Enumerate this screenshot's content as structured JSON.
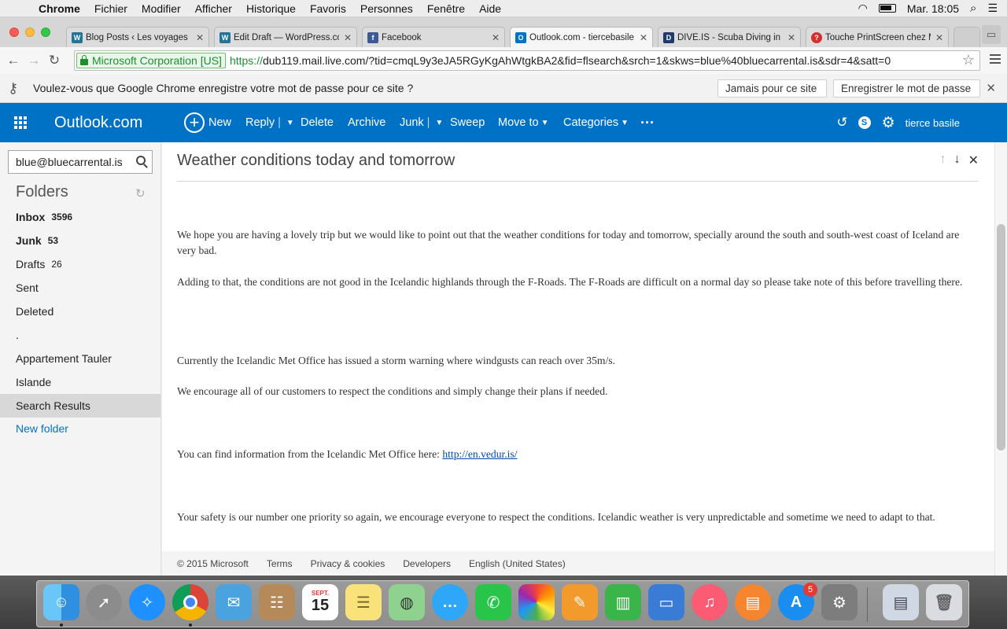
{
  "menubar": {
    "app": "Chrome",
    "items": [
      "Fichier",
      "Modifier",
      "Afficher",
      "Historique",
      "Favoris",
      "Personnes",
      "Fenêtre",
      "Aide"
    ],
    "clock": "Mar. 18:05"
  },
  "tabs": [
    {
      "title": "Blog Posts ‹ Les voyages",
      "icon": "wordpress-icon",
      "color": "#21759b",
      "glyph": "W"
    },
    {
      "title": "Edit Draft — WordPress.co",
      "icon": "wordpress-icon",
      "color": "#21759b",
      "glyph": "W"
    },
    {
      "title": "Facebook",
      "icon": "facebook-icon",
      "color": "#3b5998",
      "glyph": "f"
    },
    {
      "title": "Outlook.com - tiercebasile",
      "icon": "outlook-icon",
      "color": "#0072c6",
      "glyph": "O"
    },
    {
      "title": "DIVE.IS - Scuba Diving in Ic",
      "icon": "dive-icon",
      "color": "#1e3a6e",
      "glyph": "D"
    },
    {
      "title": "Touche PrintScreen chez M",
      "icon": "question-icon",
      "color": "#d32f2f",
      "glyph": "?"
    }
  ],
  "address": {
    "ev_label": "Microsoft Corporation [US]",
    "scheme": "https://",
    "rest": "dub119.mail.live.com/?tid=cmqL9y3eJA5RGyKgAhWtgkBA2&fid=flsearch&srch=1&skws=blue%40bluecarrental.is&sdr=4&satt=0"
  },
  "password_bar": {
    "message": "Voulez-vous que Google Chrome enregistre votre mot de passe pour ce site ?",
    "never": "Jamais pour ce site",
    "save": "Enregistrer le mot de passe"
  },
  "outlook": {
    "brand": "Outlook.com",
    "commands": {
      "new": "New",
      "reply": "Reply",
      "delete": "Delete",
      "archive": "Archive",
      "junk": "Junk",
      "sweep": "Sweep",
      "move_to": "Move to",
      "categories": "Categories"
    },
    "user": "tierce basile",
    "brand_color": "#0072c6"
  },
  "nav": {
    "search_value": "blue@bluecarrental.is",
    "folders_title": "Folders",
    "folders": [
      {
        "label": "Inbox",
        "count": "3596"
      },
      {
        "label": "Junk",
        "count": "53"
      },
      {
        "label": "Drafts",
        "count": "26"
      },
      {
        "label": "Sent",
        "count": ""
      },
      {
        "label": "Deleted",
        "count": ""
      },
      {
        "label": ".",
        "count": ""
      },
      {
        "label": "Appartement Tauler",
        "count": ""
      },
      {
        "label": "Islande",
        "count": ""
      },
      {
        "label": "Search Results",
        "count": ""
      }
    ],
    "new_folder": "New folder"
  },
  "message": {
    "subject": "Weather conditions today and tomorrow",
    "p1": "We hope you are having a lovely trip but we would like to point out that the weather conditions for today and tomorrow, specially around the south and south-west coast of Iceland are very bad.",
    "p2": "Adding to that, the conditions are not good in the Icelandic highlands through the F-Roads. The F-Roads are difficult on a normal day so please take note of this before travelling there.",
    "p3": "Currently the Icelandic Met Office has issued a storm warning where windgusts can reach over 35m/s.",
    "p4": "We encourage all of our customers to respect the conditions and simply change their plans if needed.",
    "p5_text": "You can find information from the Icelandic Met Office here: ",
    "p5_link": "http://en.vedur.is/",
    "p6": "Your safety is our number one priority so again, we encourage everyone to respect the conditions. Icelandic weather is very unpredictable and sometime we need to adapt to that."
  },
  "footer": {
    "copyright": "© 2015 Microsoft",
    "terms": "Terms",
    "privacy": "Privacy & cookies",
    "developers": "Developers",
    "language": "English (United States)"
  },
  "dock": {
    "calendar_month": "SEPT.",
    "calendar_day": "15",
    "appstore_badge": "5"
  }
}
